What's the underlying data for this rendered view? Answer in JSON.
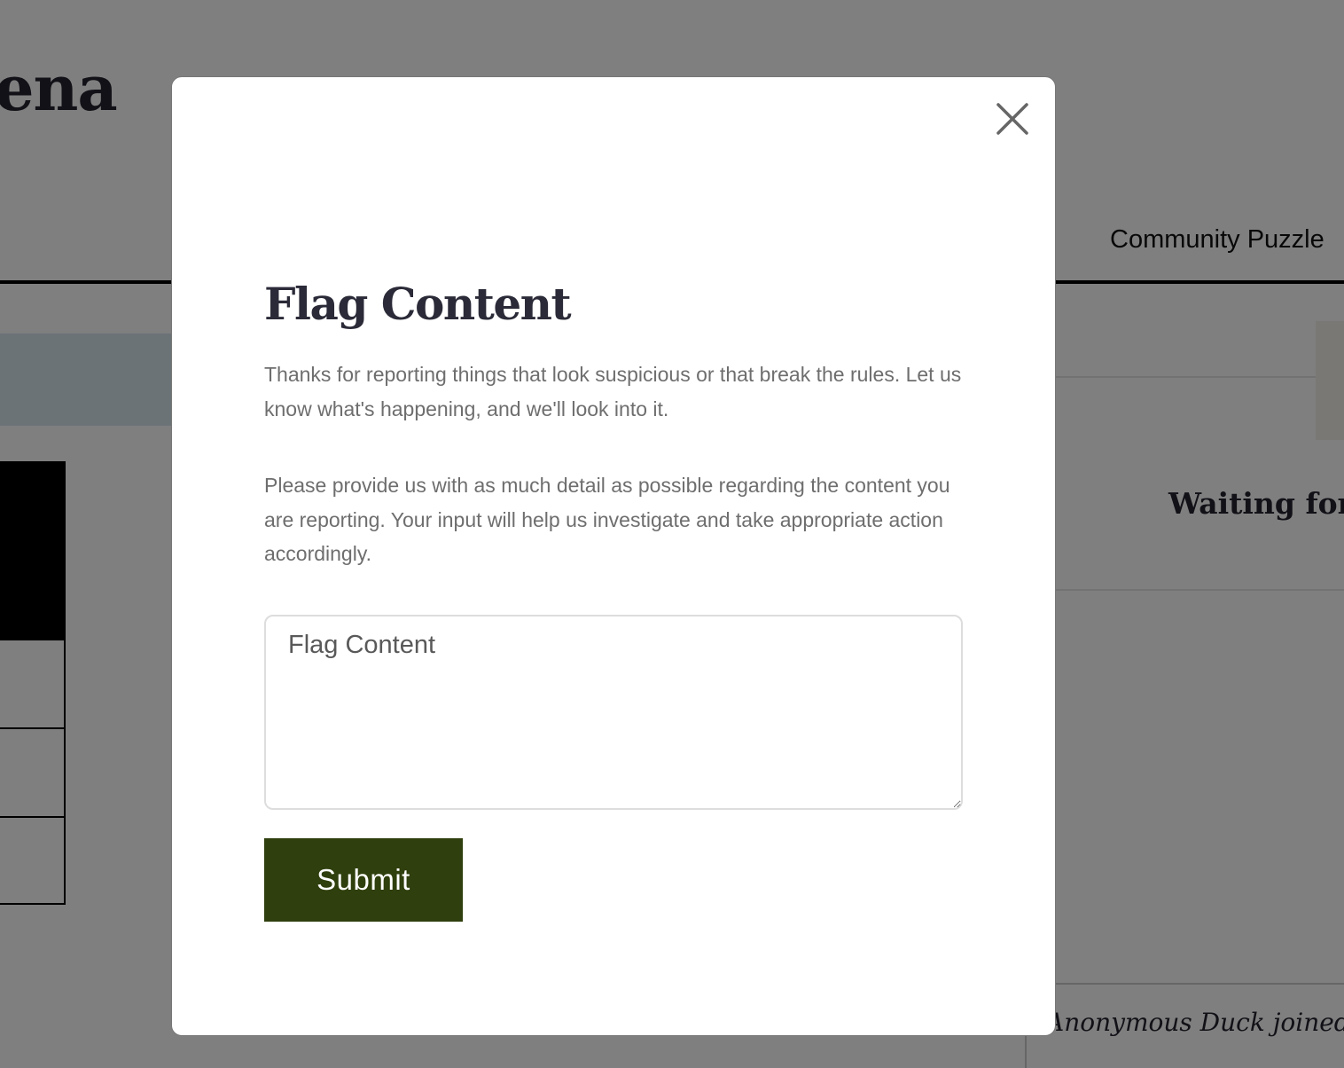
{
  "background": {
    "logo_fragment": "ena",
    "nav_link": "Community Puzzle",
    "waiting_text": "Waiting for c",
    "chat_message": "Anonymous Duck joined th"
  },
  "modal": {
    "title": "Flag Content",
    "paragraph_1": "Thanks for reporting things that look suspicious or that break the rules. Let us know what's happening, and we'll look into it.",
    "paragraph_2": "Please provide us with as much detail as possible regarding the content you are reporting. Your input will help us investigate and take appropriate action accordingly.",
    "textarea_placeholder": "Flag Content",
    "textarea_value": "",
    "submit_label": "Submit",
    "close_icon": "close-icon"
  },
  "colors": {
    "overlay": "rgba(0,0,0,0.5)",
    "submit_button": "#2f3f0d",
    "title_text": "#2a2a38",
    "body_text": "#6e6e6e"
  }
}
